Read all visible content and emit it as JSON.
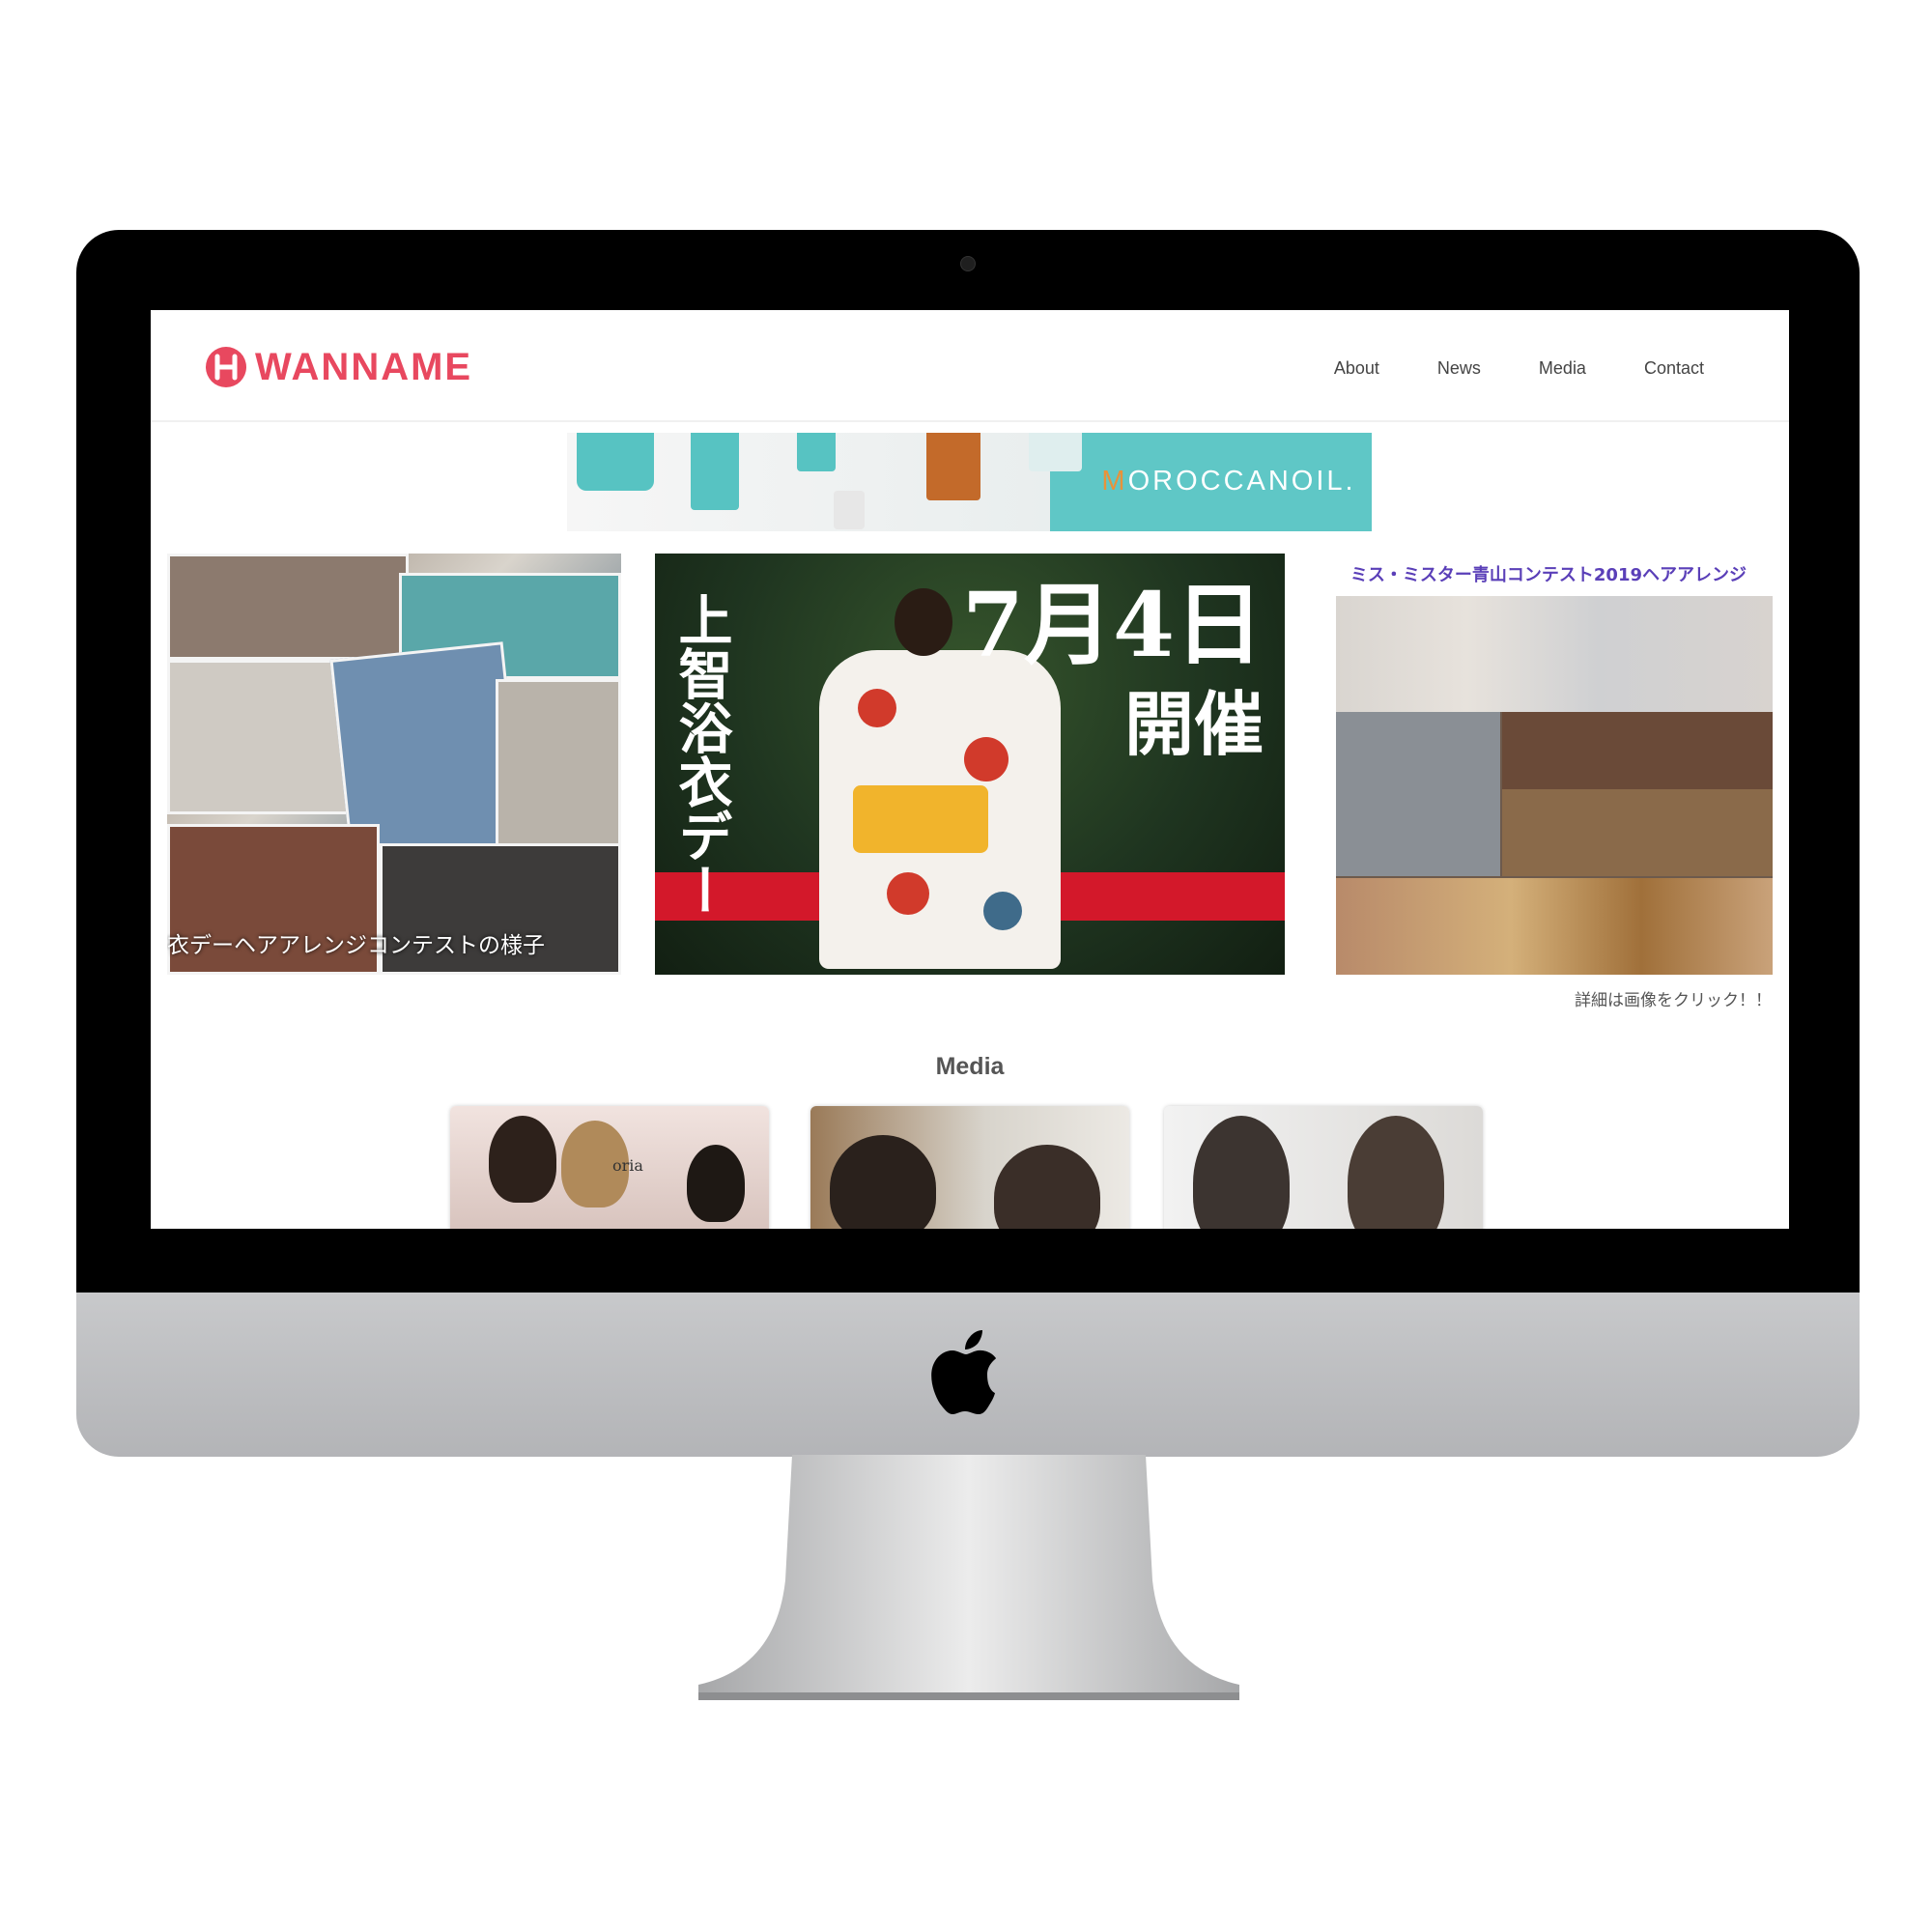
{
  "header": {
    "logo_text": "WANNAME",
    "nav": [
      "About",
      "News",
      "Media",
      "Contact"
    ]
  },
  "banner": {
    "brand": "OROCCANOIL.",
    "brand_first_letter": "M"
  },
  "hero": {
    "left_caption": "衣デーヘアアレンジコンテストの様子",
    "center_vertical_title": "上智浴衣デー",
    "center_date": "7月4日",
    "center_held": "開催",
    "right_title": "ミス・ミスター青山コンテスト2019ヘアアレンジ",
    "right_note": "詳細は画像をクリック！！"
  },
  "media": {
    "title": "Media",
    "card_1_label": "oria"
  },
  "colors": {
    "brand": "#e8485f",
    "moroccan_teal": "#5fc7c6",
    "link_purple": "#5a3fb8"
  },
  "icons": [
    "logo-icon",
    "camera-icon",
    "apple-logo-icon"
  ]
}
